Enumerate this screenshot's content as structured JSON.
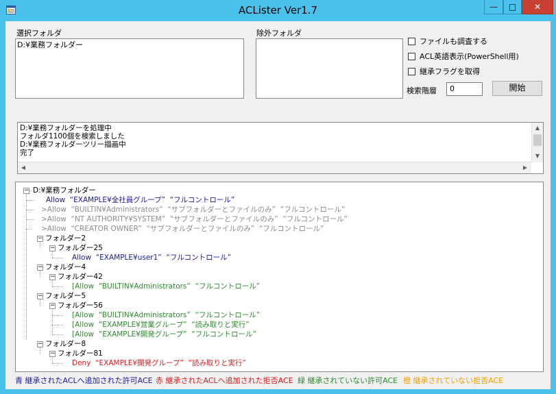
{
  "window": {
    "title": "ACLister Ver1.7"
  },
  "controls": {
    "minimize": "—",
    "maximize": "□",
    "close": "✕"
  },
  "selected_folder": {
    "label": "選択フォルダ",
    "value": "D:¥業務フォルダー"
  },
  "excluded_folder": {
    "label": "除外フォルダ",
    "value": ""
  },
  "options": [
    {
      "label": "ファイルも調査する",
      "checked": false
    },
    {
      "label": "ACL英語表示(PowerShell用)",
      "checked": false
    },
    {
      "label": "継承フラグを取得",
      "checked": false
    }
  ],
  "depth": {
    "label": "検索階層",
    "value": "0"
  },
  "start_button": "開始",
  "log": [
    "D:¥業務フォルダーを処理中",
    "フォルダ1100個を検索しました",
    "D:¥業務フォルダーツリー描画中",
    "完了"
  ],
  "tree": [
    {
      "text": "D:¥業務フォルダー",
      "color": "#000000"
    },
    {
      "text": "Allow  “EXAMPLE¥全社員グループ”  “フルコントロール”",
      "color": "#1a1a9c"
    },
    {
      "text": ">Allow  “BUILTIN¥Administrators”  “サブフォルダーとファイルのみ”  “フルコントロール”",
      "color": "#8c8c8c"
    },
    {
      "text": ">Allow  “NT AUTHORITY¥SYSTEM”  “サブフォルダーとファイルのみ”  “フルコントロール”",
      "color": "#8c8c8c"
    },
    {
      "text": ">Allow  “CREATOR OWNER”  “サブフォルダーとファイルのみ”  “フルコントロール”",
      "color": "#8c8c8c"
    },
    {
      "text": "フォルダー2",
      "color": "#000000"
    },
    {
      "text": "フォルダー25",
      "color": "#000000"
    },
    {
      "text": "Allow  “EXAMPLE¥user1”  “フルコントロール”",
      "color": "#1a1a9c"
    },
    {
      "text": "フォルダー4",
      "color": "#000000"
    },
    {
      "text": "フォルダー42",
      "color": "#000000"
    },
    {
      "text": "[Allow  “BUILTIN¥Administrators”  “フルコントロール”",
      "color": "#2e8b2e"
    },
    {
      "text": "フォルダー5",
      "color": "#000000"
    },
    {
      "text": "フォルダー56",
      "color": "#000000"
    },
    {
      "text": "[Allow  “BUILTIN¥Administrators”  “フルコントロール”",
      "color": "#2e8b2e"
    },
    {
      "text": "[Allow  “EXAMPLE¥営業グループ”  “読み取りと実行”",
      "color": "#2e8b2e"
    },
    {
      "text": "[Allow  “EXAMPLE¥開発グループ”  “フルコントロール”",
      "color": "#2e8b2e"
    },
    {
      "text": "フォルダー8",
      "color": "#000000"
    },
    {
      "text": "フォルダー81",
      "color": "#000000"
    },
    {
      "text": "Deny  “EXAMPLE¥開発グループ”  “読み取りと実行”",
      "color": "#d42020"
    }
  ],
  "legend": [
    {
      "text": "青 継承されたACLへ追加された許可ACE",
      "color": "#1a1a9c"
    },
    {
      "text": "赤 継承されたACLへ追加された拒否ACE",
      "color": "#d42020"
    },
    {
      "text": "緑 継承されていない許可ACE",
      "color": "#2e8b2e"
    },
    {
      "text": "橙 継承されていない拒否ACE",
      "color": "#f0a000"
    }
  ]
}
